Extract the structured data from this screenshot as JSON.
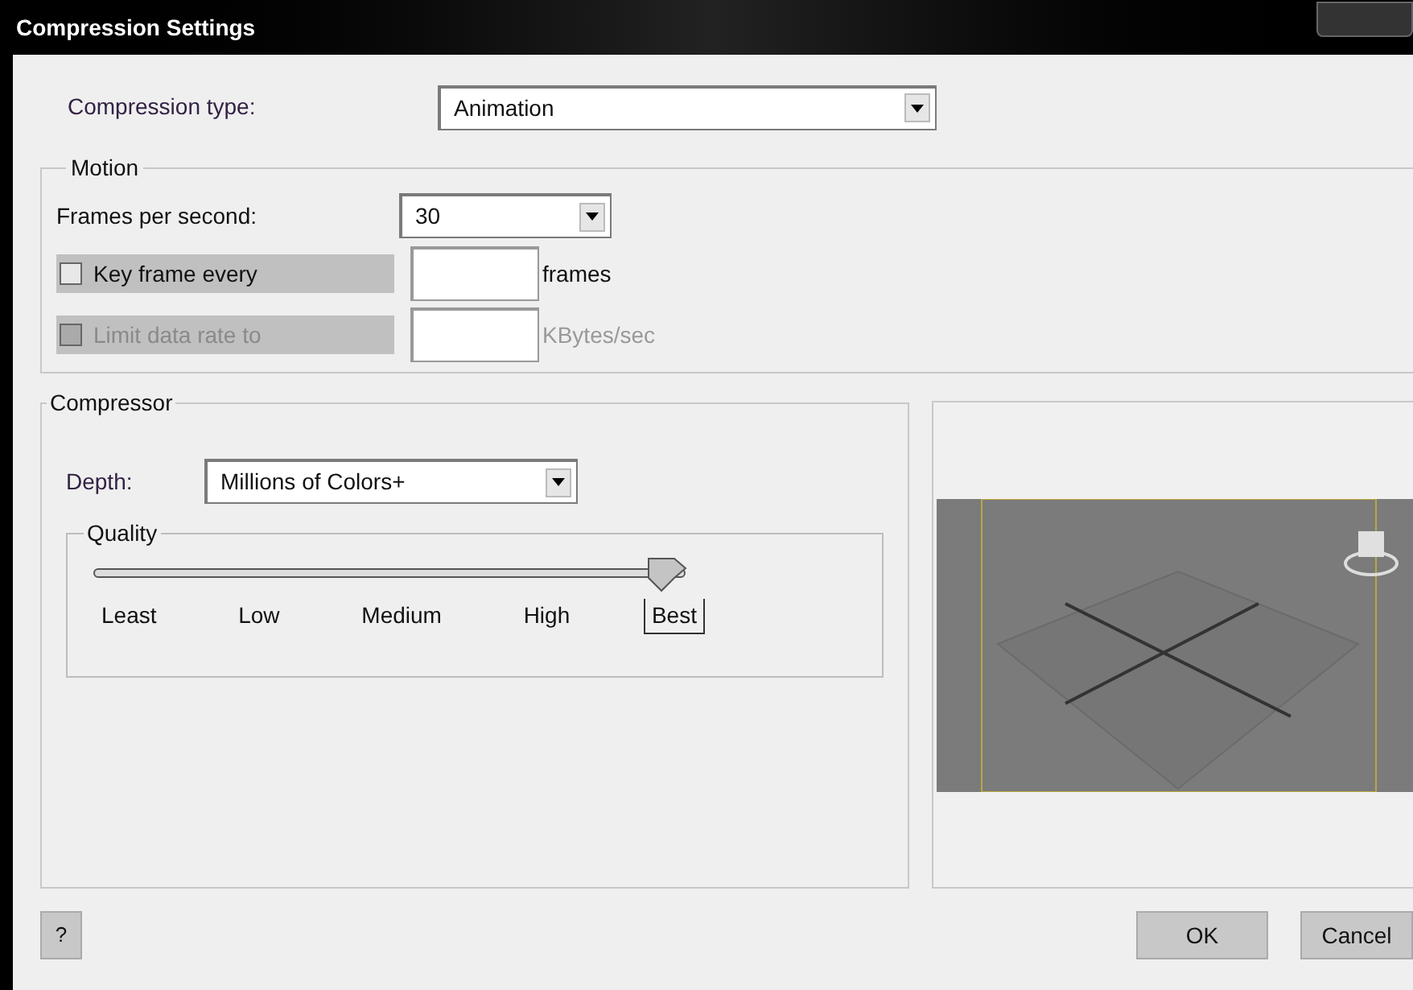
{
  "window": {
    "title": "Compression Settings"
  },
  "compression_type": {
    "label": "Compression type:",
    "value": "Animation"
  },
  "motion": {
    "title": "Motion",
    "fps": {
      "label": "Frames per second:",
      "value": "30"
    },
    "options": [
      {
        "label": "Key frame every",
        "checked": false,
        "disabled": false,
        "unit": "frames"
      },
      {
        "label": "Limit data rate to",
        "checked": false,
        "disabled": true,
        "unit": "KBytes/sec"
      }
    ]
  },
  "compressor": {
    "title": "Compressor",
    "depth": {
      "label": "Depth:",
      "value": "Millions of Colors+"
    },
    "quality": {
      "title": "Quality",
      "level": 1,
      "ticks": [
        {
          "label": "Least",
          "selected": false
        },
        {
          "label": "Low",
          "selected": false
        },
        {
          "label": "Medium",
          "selected": false
        },
        {
          "label": "High",
          "selected": false
        },
        {
          "label": "Best",
          "selected": true
        }
      ]
    }
  },
  "buttons": {
    "help": "?",
    "ok": "OK",
    "cancel": "Cancel"
  }
}
